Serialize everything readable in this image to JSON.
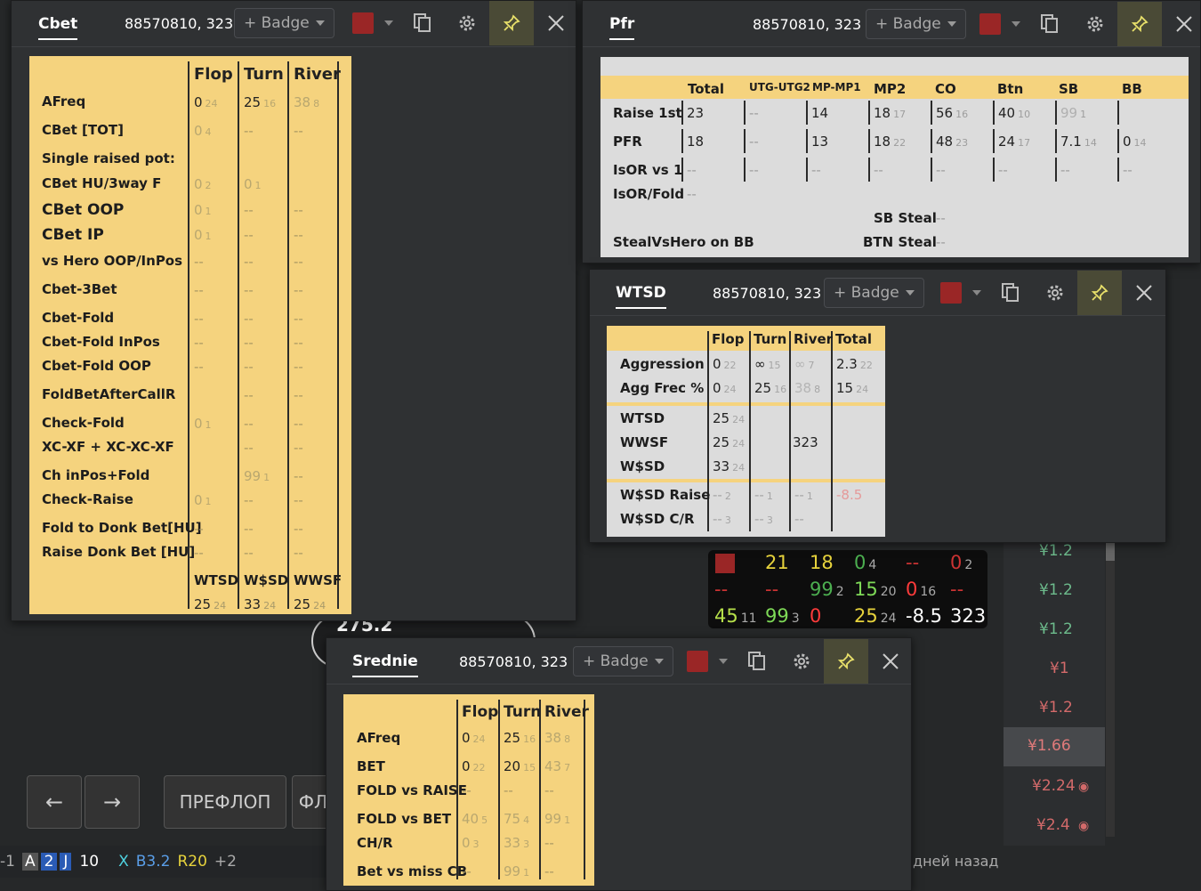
{
  "cbet": {
    "title": "Cbet",
    "player": "88570810, 323",
    "badge": "+ Badge",
    "cols": [
      "Flop",
      "Turn",
      "River"
    ],
    "rows": [
      {
        "label": "AFreq",
        "c": [
          [
            "0",
            "24"
          ],
          [
            "25",
            "16"
          ],
          [
            "38",
            "8"
          ]
        ]
      },
      {
        "label": "CBet [TOT]",
        "c": [
          [
            "0",
            "4"
          ],
          [
            "--",
            ""
          ],
          [
            "--",
            ""
          ]
        ]
      },
      {
        "label": "Single raised pot:",
        "c": [
          [
            "",
            ""
          ],
          [
            "",
            ""
          ],
          [
            "",
            ""
          ]
        ]
      },
      {
        "label": "CBet HU/3way F",
        "c": [
          [
            "0",
            "2"
          ],
          [
            "0",
            "1"
          ],
          [
            "",
            ""
          ]
        ]
      },
      {
        "label": "CBet OOP",
        "c": [
          [
            "0",
            "1"
          ],
          [
            "--",
            ""
          ],
          [
            "--",
            ""
          ]
        ]
      },
      {
        "label": "CBet IP",
        "c": [
          [
            "0",
            "1"
          ],
          [
            "--",
            ""
          ],
          [
            "--",
            ""
          ]
        ]
      },
      {
        "label": "vs Hero OOP/InPos",
        "c": [
          [
            "--",
            ""
          ],
          [
            "--",
            ""
          ],
          [
            "--",
            ""
          ]
        ]
      },
      {
        "label": "Cbet-3Bet",
        "c": [
          [
            "--",
            ""
          ],
          [
            "--",
            ""
          ],
          [
            "--",
            ""
          ]
        ]
      },
      {
        "label": "Cbet-Fold",
        "c": [
          [
            "--",
            ""
          ],
          [
            "--",
            ""
          ],
          [
            "--",
            ""
          ]
        ]
      },
      {
        "label": "Cbet-Fold InPos",
        "c": [
          [
            "--",
            ""
          ],
          [
            "--",
            ""
          ],
          [
            "--",
            ""
          ]
        ]
      },
      {
        "label": "Cbet-Fold OOP",
        "c": [
          [
            "--",
            ""
          ],
          [
            "--",
            ""
          ],
          [
            "--",
            ""
          ]
        ]
      },
      {
        "label": "FoldBetAfterCallR",
        "c": [
          [
            "",
            ""
          ],
          [
            "--",
            ""
          ],
          [
            "--",
            ""
          ]
        ]
      },
      {
        "label": "Check-Fold",
        "c": [
          [
            "0",
            "1"
          ],
          [
            "--",
            ""
          ],
          [
            "--",
            ""
          ]
        ]
      },
      {
        "label": "XC-XF + XC-XC-XF",
        "c": [
          [
            "",
            ""
          ],
          [
            "--",
            ""
          ],
          [
            "--",
            ""
          ]
        ]
      },
      {
        "label": "Ch inPos+Fold",
        "c": [
          [
            "",
            ""
          ],
          [
            "99",
            "1"
          ],
          [
            "--",
            ""
          ]
        ]
      },
      {
        "label": "Check-Raise",
        "c": [
          [
            "0",
            "1"
          ],
          [
            "--",
            ""
          ],
          [
            "--",
            ""
          ]
        ]
      },
      {
        "label": "Fold to Donk Bet[HU]",
        "c": [
          [
            "--",
            ""
          ],
          [
            "--",
            ""
          ],
          [
            "--",
            ""
          ]
        ]
      },
      {
        "label": "Raise Donk Bet [HU]",
        "c": [
          [
            "--",
            ""
          ],
          [
            "--",
            ""
          ],
          [
            "--",
            ""
          ]
        ]
      }
    ],
    "foot_h": [
      "WTSD",
      "W$SD",
      "WWSF"
    ],
    "foot_v": [
      [
        "25",
        "24"
      ],
      [
        "33",
        "24"
      ],
      [
        "25",
        "24"
      ]
    ]
  },
  "pfr": {
    "title": "Pfr",
    "player": "88570810, 323",
    "badge": "+ Badge",
    "cols": [
      "Total",
      "UTG-UTG2",
      "MP-MP1",
      "MP2",
      "CO",
      "Btn",
      "SB",
      "BB"
    ],
    "rows": [
      {
        "label": "Raise 1st",
        "c": [
          [
            "23",
            ""
          ],
          [
            "--",
            ""
          ],
          [
            "14",
            ""
          ],
          [
            "18",
            "17"
          ],
          [
            "56",
            "16"
          ],
          [
            "40",
            "10"
          ],
          [
            "99",
            "1"
          ],
          [
            "",
            ""
          ]
        ]
      },
      {
        "label": "PFR",
        "c": [
          [
            "18",
            ""
          ],
          [
            "--",
            ""
          ],
          [
            "13",
            ""
          ],
          [
            "18",
            "22"
          ],
          [
            "48",
            "23"
          ],
          [
            "24",
            "17"
          ],
          [
            "7.1",
            "14"
          ],
          [
            "0",
            "14"
          ]
        ]
      },
      {
        "label": "IsOR vs 1",
        "c": [
          [
            "--",
            ""
          ],
          [
            "--",
            ""
          ],
          [
            "--",
            ""
          ],
          [
            "--",
            ""
          ],
          [
            "--",
            ""
          ],
          [
            "--",
            ""
          ],
          [
            "--",
            ""
          ],
          [
            "--",
            ""
          ]
        ]
      }
    ],
    "isorfold": "IsOR/Fold",
    "isorfold_v": "--",
    "sbsteal": "SB Steal",
    "sbsteal_v": "--",
    "svh": "StealVsHero on BB",
    "btnsteal": "BTN Steal",
    "btnsteal_v": "--"
  },
  "wtsd": {
    "title": "WTSD",
    "player": "88570810, 323",
    "badge": "+ Badge",
    "cols": [
      "Flop",
      "Turn",
      "River",
      "Total"
    ],
    "r1": [
      {
        "label": "Aggression",
        "c": [
          [
            "0",
            "22"
          ],
          [
            "∞",
            "15"
          ],
          [
            "∞",
            "7"
          ],
          [
            "2.3",
            "22"
          ]
        ]
      },
      {
        "label": "Agg Frec %",
        "c": [
          [
            "0",
            "24"
          ],
          [
            "25",
            "16"
          ],
          [
            "38",
            "8"
          ],
          [
            "15",
            "24"
          ]
        ]
      }
    ],
    "r2": [
      {
        "label": "WTSD",
        "c": [
          [
            "25",
            "24"
          ],
          [
            "",
            ""
          ],
          [
            "",
            ""
          ],
          [
            "",
            ""
          ]
        ]
      },
      {
        "label": "WWSF",
        "c": [
          [
            "25",
            "24"
          ],
          [
            "",
            ""
          ],
          [
            "323",
            ""
          ],
          [
            "",
            ""
          ]
        ]
      },
      {
        "label": "W$SD",
        "c": [
          [
            "33",
            "24"
          ],
          [
            "",
            ""
          ],
          [
            "",
            ""
          ],
          [
            "",
            ""
          ]
        ]
      }
    ],
    "r3": [
      {
        "label": "W$SD Raise",
        "c": [
          [
            "--",
            "2"
          ],
          [
            "--",
            "1"
          ],
          [
            "--",
            "1"
          ],
          [
            "-8.5",
            ""
          ]
        ]
      },
      {
        "label": "W$SD C/R",
        "c": [
          [
            "--",
            "3"
          ],
          [
            "--",
            "3"
          ],
          [
            "--",
            ""
          ],
          [
            "",
            ""
          ]
        ]
      }
    ]
  },
  "srednie": {
    "title": "Srednie",
    "player": "88570810, 323",
    "badge": "+ Badge",
    "cols": [
      "Flop",
      "Turn",
      "River"
    ],
    "rows": [
      {
        "label": "AFreq",
        "c": [
          [
            "0",
            "24"
          ],
          [
            "25",
            "16"
          ],
          [
            "38",
            "8"
          ]
        ]
      },
      {
        "label": "BET",
        "c": [
          [
            "0",
            "22"
          ],
          [
            "20",
            "15"
          ],
          [
            "43",
            "7"
          ]
        ]
      },
      {
        "label": "FOLD vs RAISE",
        "c": [
          [
            "--",
            ""
          ],
          [
            "--",
            ""
          ],
          [
            "--",
            ""
          ]
        ]
      },
      {
        "label": "FOLD vs BET",
        "c": [
          [
            "40",
            "5"
          ],
          [
            "75",
            "4"
          ],
          [
            "99",
            "1"
          ]
        ]
      },
      {
        "label": "CH/R",
        "c": [
          [
            "0",
            "3"
          ],
          [
            "33",
            "3"
          ],
          [
            "--",
            ""
          ]
        ]
      },
      {
        "label": "Bet vs miss CB",
        "c": [
          [
            "--",
            ""
          ],
          [
            "99",
            "1"
          ],
          [
            "--",
            ""
          ]
        ]
      }
    ]
  },
  "hud": {
    "r1": [
      [
        "21",
        ""
      ],
      [
        "18",
        ""
      ],
      [
        "0",
        "4"
      ],
      [
        "--",
        ""
      ],
      [
        "0",
        "2"
      ]
    ],
    "r2": [
      [
        "--",
        ""
      ],
      [
        "--",
        ""
      ],
      [
        "99",
        "2"
      ],
      [
        "15",
        "20"
      ],
      [
        "0",
        "16"
      ],
      [
        "--",
        ""
      ]
    ],
    "r3": [
      [
        "45",
        "11"
      ],
      [
        "99",
        "3"
      ],
      [
        "0",
        ""
      ],
      [
        "25",
        "24"
      ],
      [
        "-8.5",
        ""
      ],
      [
        "323",
        ""
      ]
    ]
  },
  "side": {
    "prices": [
      "¥1.2",
      "¥1.2",
      "¥1.2",
      "¥1",
      "¥1.2",
      "¥1.66",
      "¥2.24",
      "¥2.4"
    ]
  },
  "bg": {
    "pot": "275.2",
    "preflop": "ПРЕФЛОП",
    "fl": "ФЛ",
    "bottom_text": "дней назад",
    "cards": [
      "A",
      "2",
      "J",
      "10"
    ],
    "actions": [
      "X",
      "B3.2",
      "R20",
      "+2"
    ],
    "left_num": "-1"
  }
}
